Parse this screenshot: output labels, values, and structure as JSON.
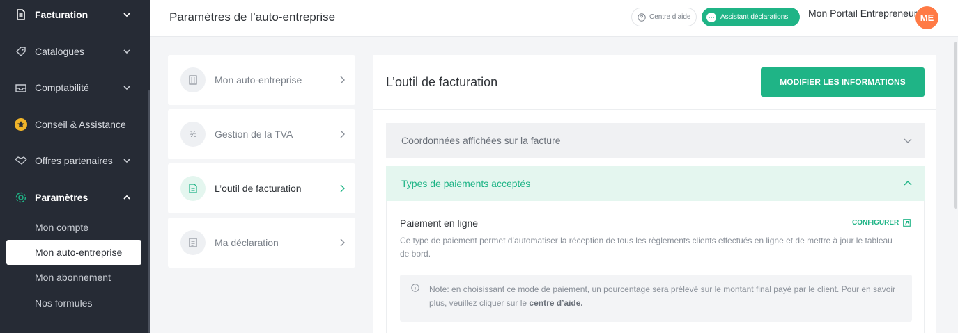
{
  "sidebar": {
    "items": [
      {
        "label": "Facturation",
        "icon": "document-icon"
      },
      {
        "label": "Catalogues",
        "icon": "tag-icon"
      },
      {
        "label": "Comptabilité",
        "icon": "inbox-icon"
      },
      {
        "label": "Conseil & Assistance",
        "icon": "star-icon"
      },
      {
        "label": "Offres partenaires",
        "icon": "handshake-icon"
      },
      {
        "label": "Paramètres",
        "icon": "gear-icon"
      }
    ],
    "subitems": [
      {
        "label": "Mon compte"
      },
      {
        "label": "Mon auto-entreprise"
      },
      {
        "label": "Mon abonnement"
      },
      {
        "label": "Nos formules"
      }
    ]
  },
  "header": {
    "title": "Paramètres de l’auto-entreprise",
    "help_label": "Centre d’aide",
    "assist_label": "Assistant déclarations",
    "portal_name": "Mon Portail Entrepreneur",
    "avatar_initials": "ME"
  },
  "menu": [
    {
      "label": "Mon auto-entreprise",
      "icon": "building-icon"
    },
    {
      "label": "Gestion de la TVA",
      "icon": "%"
    },
    {
      "label": "L’outil de facturation",
      "icon": "invoice-icon"
    },
    {
      "label": "Ma déclaration",
      "icon": "declaration-icon"
    }
  ],
  "panel": {
    "title": "L’outil de facturation",
    "modify_label": "MODIFIER LES INFORMATIONS",
    "accordion_1": "Coordonnées affichées sur la facture",
    "accordion_2": "Types de paiements acceptés",
    "payment_title": "Paiement en ligne",
    "configure_label": "CONFIGURER",
    "payment_desc": "Ce type de paiement permet d’automatiser la réception de tous les règlements clients effectués en ligne et de mettre à jour le tableau de bord.",
    "note_text": "Note: en choisissant ce mode de paiement, un pourcentage sera prélevé sur le montant final payé par le client. Pour en savoir plus, veuillez cliquer sur le ",
    "note_link": "centre d’aide."
  },
  "colors": {
    "sidebar_bg": "#262b35",
    "accent_green": "#1fb486",
    "accent_green_light": "#e4f6ef",
    "avatar_bg": "#ff7a45",
    "star_gold": "#f0b429"
  }
}
